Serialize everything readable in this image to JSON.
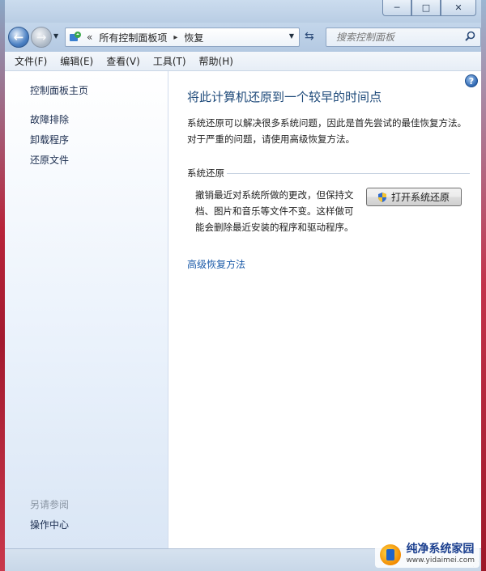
{
  "window": {
    "controls": {
      "minimize": "─",
      "maximize": "□",
      "close": "✕"
    }
  },
  "nav": {
    "back_icon": "←",
    "forward_icon": "→",
    "breadcrumb": [
      "所有控制面板项",
      "恢复"
    ],
    "overflow": "«",
    "search_placeholder": "搜索控制面板"
  },
  "menu": [
    "文件(F)",
    "编辑(E)",
    "查看(V)",
    "工具(T)",
    "帮助(H)"
  ],
  "sidebar": {
    "home": "控制面板主页",
    "items": [
      "故障排除",
      "卸载程序",
      "还原文件"
    ],
    "see_also_title": "另请参阅",
    "see_also_items": [
      "操作中心"
    ]
  },
  "main": {
    "help": "?",
    "title": "将此计算机还原到一个较早的时间点",
    "description": "系统还原可以解决很多系统问题，因此是首先尝试的最佳恢复方法。对于严重的问题，请使用高级恢复方法。",
    "section_label": "系统还原",
    "section_description": "撤销最近对系统所做的更改，但保持文档、图片和音乐等文件不变。这样做可能会删除最近安装的程序和驱动程序。",
    "open_button": "打开系统还原",
    "advanced_link": "高级恢复方法"
  },
  "watermark": {
    "name": "纯净系统家园",
    "url": "www.yidaimei.com"
  },
  "colors": {
    "accent_title": "#1e4a7a",
    "link": "#1a5aa8",
    "wallpaper": "#b8243a"
  }
}
